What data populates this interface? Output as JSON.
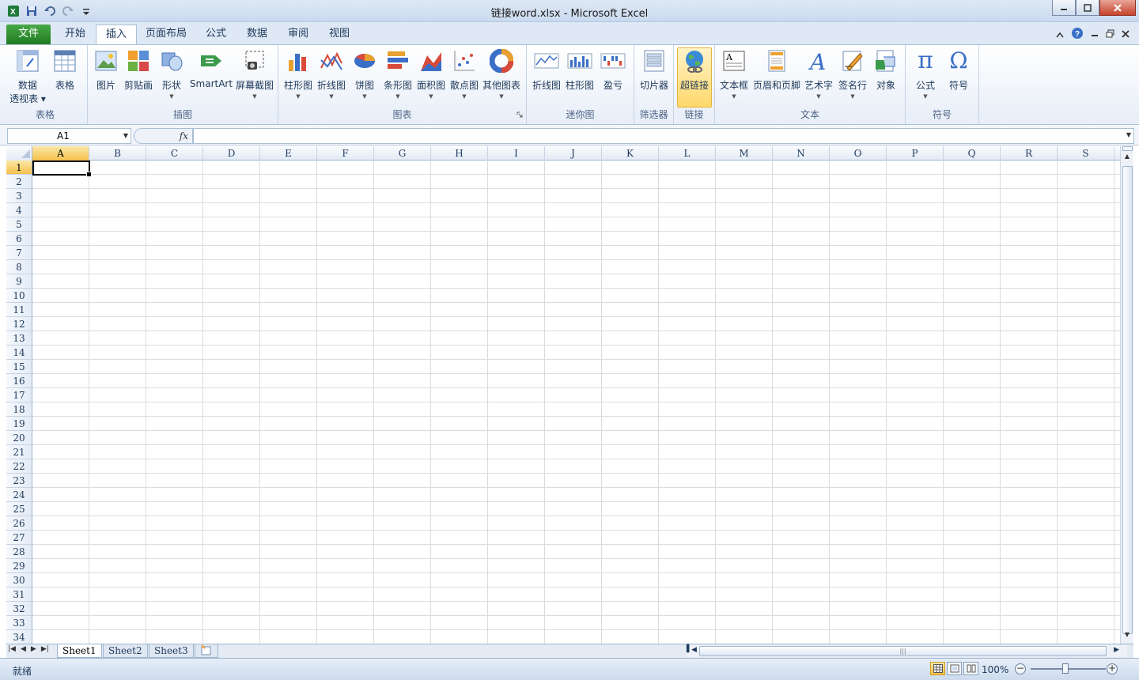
{
  "window": {
    "title": "链接word.xlsx  -  Microsoft Excel"
  },
  "qat": {
    "icons": [
      "excel-logo-icon",
      "save-icon",
      "undo-icon",
      "redo-icon",
      "customize-icon"
    ]
  },
  "tabs": [
    {
      "label": "文件"
    },
    {
      "label": "开始"
    },
    {
      "label": "插入"
    },
    {
      "label": "页面布局"
    },
    {
      "label": "公式"
    },
    {
      "label": "数据"
    },
    {
      "label": "审阅"
    },
    {
      "label": "视图"
    }
  ],
  "ribbon": {
    "groups": [
      {
        "label": "表格"
      },
      {
        "label": "插图"
      },
      {
        "label": "图表"
      },
      {
        "label": "迷你图"
      },
      {
        "label": "筛选器"
      },
      {
        "label": "链接"
      },
      {
        "label": "文本"
      },
      {
        "label": "符号"
      }
    ],
    "buttons": {
      "pivot_l1": "数据",
      "pivot_l2": "透视表",
      "table": "表格",
      "picture": "图片",
      "clipart": "剪贴画",
      "shapes": "形状",
      "smartart": "SmartArt",
      "screenshot": "屏幕截图",
      "column": "柱形图",
      "line": "折线图",
      "pie": "饼图",
      "bar": "条形图",
      "area": "面积图",
      "scatter": "散点图",
      "other": "其他图表",
      "spark_line": "折线图",
      "spark_col": "柱形图",
      "spark_wl": "盈亏",
      "slicer": "切片器",
      "hyperlink": "超链接",
      "textbox": "文本框",
      "header": "页眉和页脚",
      "wordart": "艺术字",
      "sigline": "签名行",
      "object": "对象",
      "equation": "公式",
      "symbol": "符号"
    },
    "symbols": {
      "pi": "π",
      "omega": "Ω",
      "wordart_a": "A",
      "textbox_a": "A"
    }
  },
  "formula": {
    "namebox": "A1",
    "fx": "fx",
    "value": ""
  },
  "columns": [
    "A",
    "B",
    "C",
    "D",
    "E",
    "F",
    "G",
    "H",
    "I",
    "J",
    "K",
    "L",
    "M",
    "N",
    "O",
    "P",
    "Q",
    "R",
    "S"
  ],
  "rows": [
    "1",
    "2",
    "3",
    "4",
    "5",
    "6",
    "7",
    "8",
    "9",
    "10",
    "11",
    "12",
    "13",
    "14",
    "15",
    "16",
    "17",
    "18",
    "19",
    "20",
    "21",
    "22",
    "23",
    "24",
    "25",
    "26",
    "27",
    "28",
    "29",
    "30",
    "31",
    "32",
    "33",
    "34"
  ],
  "sheets": [
    {
      "label": "Sheet1"
    },
    {
      "label": "Sheet2"
    },
    {
      "label": "Sheet3"
    }
  ],
  "status": {
    "text": "就绪",
    "zoom": "100%"
  },
  "colors": {
    "file_tab": "#2c8b2c",
    "selected_header": "#f5c14d",
    "accent": "#1e395b"
  }
}
